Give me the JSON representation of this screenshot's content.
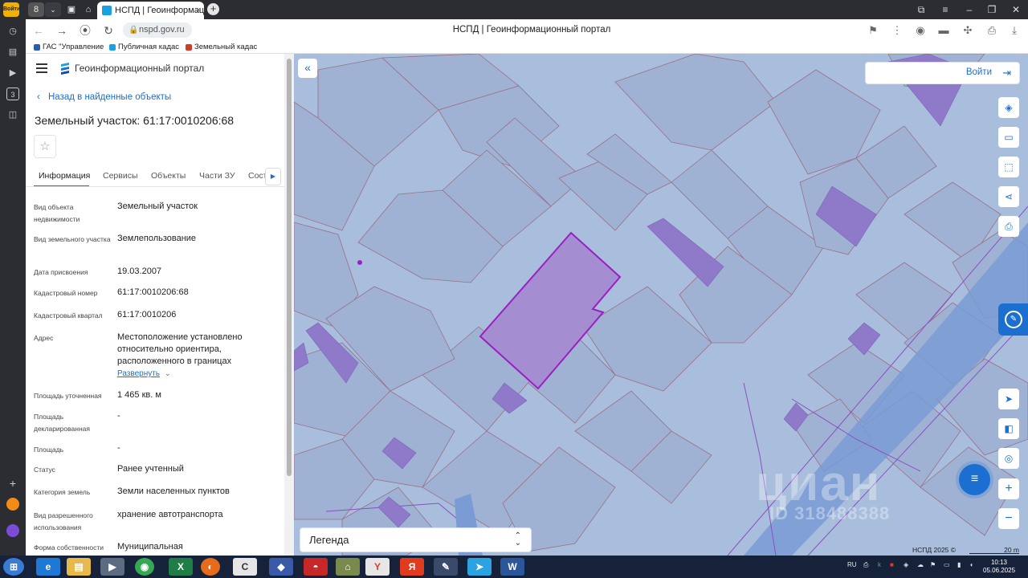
{
  "browser": {
    "tab_title": "НСПД | Геоинформационн",
    "url": "nspd.gov.ru",
    "page_title": "НСПД | Геоинформационный портал",
    "profile_badge": "Войти",
    "tab_counter": "8",
    "bookmarks": [
      {
        "label": "ГАС \"Управление",
        "color": "#2a5cb0"
      },
      {
        "label": "Публичная кадас",
        "color": "#1ba1e2"
      },
      {
        "label": "Земельный кадас",
        "color": "#d33a2c"
      }
    ],
    "sidebar_badge": "3"
  },
  "panel": {
    "portal_name": "Геоинформационный портал",
    "back_label": "Назад в найденные объекты",
    "object_title": "Земельный участок: 61:17:0010206:68",
    "tabs": [
      "Информация",
      "Сервисы",
      "Объекты",
      "Части ЗУ",
      "Сост"
    ],
    "rows": [
      {
        "label": "Вид объекта недвижимости",
        "value": "Земельный участок"
      },
      {
        "label": "Вид земельного участка",
        "value": "Землепользование"
      },
      {
        "label": "Дата присвоения",
        "value": "19.03.2007"
      },
      {
        "label": "Кадастровый номер",
        "value": "61:17:0010206:68"
      },
      {
        "label": "Кадастровый квартал",
        "value": "61:17:0010206"
      },
      {
        "label": "Адрес",
        "value": "Местоположение установлено относительно ориентира, расположенного в границах"
      },
      {
        "label": "Площадь уточненная",
        "value": "1 465 кв. м"
      },
      {
        "label": "Площадь декларированная",
        "value": "-"
      },
      {
        "label": "Площадь",
        "value": "-"
      },
      {
        "label": "Статус",
        "value": "Ранее учтенный"
      },
      {
        "label": "Категория земель",
        "value": "Земли населенных пунктов"
      },
      {
        "label": "Вид разрешенного использования",
        "value": "хранение автотранспорта"
      },
      {
        "label": "Форма собственности",
        "value": "Муниципальная"
      }
    ],
    "expand_label": "Развернуть"
  },
  "map": {
    "login_label": "Войти",
    "legend_label": "Легенда",
    "copyright": "НСПД 2025 ©",
    "scale_label": "20 m",
    "watermark": "циан",
    "watermark_id": "ID 318488388",
    "colors": {
      "background": "#a8bedc",
      "parcel_fill": "#9fb2d4",
      "parcel_stroke": "#9a6f86",
      "building": "#8f79c9",
      "selected": "#a48ed1",
      "selected_stroke": "#9b1ec1",
      "road": "#7a9bd4",
      "accent": "#1a6fd0"
    }
  },
  "taskbar": {
    "lang": "RU",
    "time": "10:13",
    "date": "05.06.2025"
  }
}
